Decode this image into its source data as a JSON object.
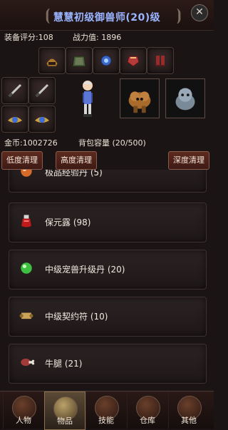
{
  "header": {
    "title": "慧慧初级御兽师(20)级",
    "close_symbol": "✕",
    "frame_left_symbol": "⦗",
    "frame_right_symbol": "⦘"
  },
  "stats": {
    "gear_score_label": "装备评分:108",
    "power_label": "战力值: 1896"
  },
  "currency": {
    "gold_label": "金币:1002726",
    "bag_label": "背包容量 (20/500)"
  },
  "buttons": {
    "low_clean": "低度清理",
    "mid_clean": "高度清理",
    "deep_clean": "深度清理"
  },
  "items": [
    {
      "name": "极品经验丹 (5)",
      "icon": "orange-orb-icon"
    },
    {
      "name": "保元露 (98)",
      "icon": "red-potion-icon"
    },
    {
      "name": "中级宠兽升级丹 (20)",
      "icon": "green-orb-icon"
    },
    {
      "name": "中级契约符 (10)",
      "icon": "scroll-icon"
    },
    {
      "name": "牛腿 (21)",
      "icon": "meat-icon"
    }
  ],
  "nav": [
    {
      "label": "人物",
      "icon": "character-icon",
      "active": false
    },
    {
      "label": "物品",
      "icon": "items-icon",
      "active": true
    },
    {
      "label": "技能",
      "icon": "skills-icon",
      "active": false
    },
    {
      "label": "仓库",
      "icon": "warehouse-icon",
      "active": false
    },
    {
      "label": "其他",
      "icon": "other-icon",
      "active": false
    }
  ],
  "equipment": [
    {
      "icon": "helmet-icon"
    },
    {
      "icon": "armor-icon"
    },
    {
      "icon": "amulet-icon"
    },
    {
      "icon": "gloves-icon"
    },
    {
      "icon": "boots-icon"
    },
    {
      "icon": "sword-icon"
    },
    {
      "icon": "sword-icon"
    },
    {
      "icon": "wing-emblem-icon"
    },
    {
      "icon": "wing-emblem-icon"
    }
  ],
  "pets": [
    {
      "icon": "dog-portrait-icon"
    },
    {
      "icon": "cat-portrait-icon"
    }
  ]
}
